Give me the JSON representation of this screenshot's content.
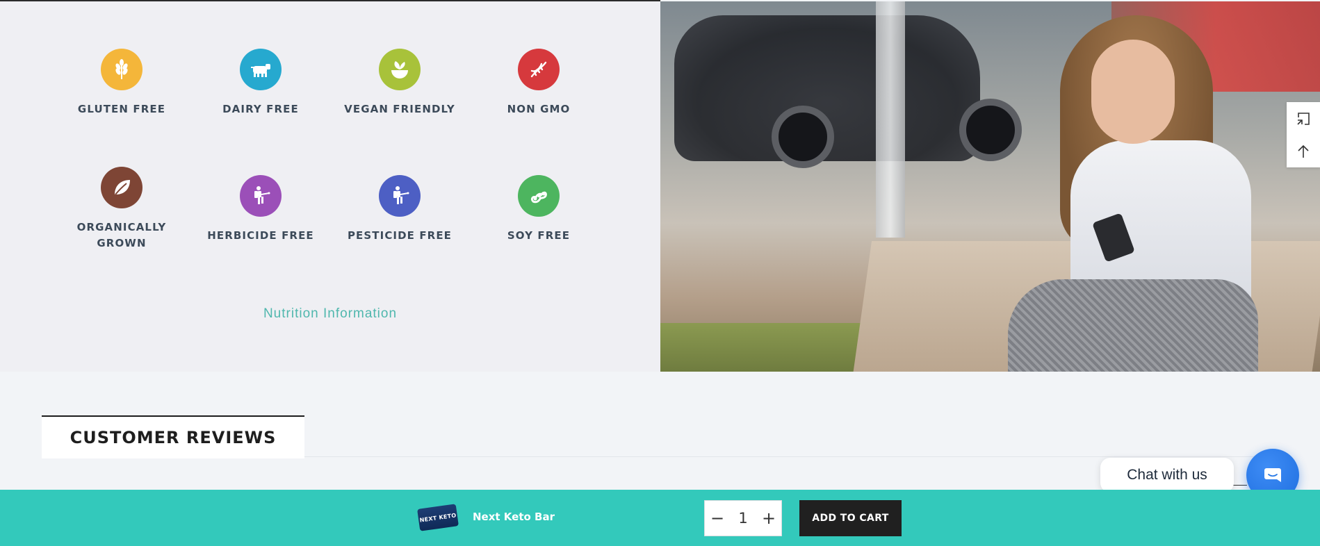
{
  "features": [
    {
      "label": "GLUTEN FREE",
      "icon": "wheat-icon",
      "color": "#f4b63a"
    },
    {
      "label": "DAIRY FREE",
      "icon": "cow-icon",
      "color": "#26a9cf"
    },
    {
      "label": "VEGAN FRIENDLY",
      "icon": "leaf-bowl-icon",
      "color": "#a8c23a"
    },
    {
      "label": "NON GMO",
      "icon": "dna-icon",
      "color": "#d6393d"
    },
    {
      "label": "ORGANICALLY GROWN",
      "icon": "leaf-icon",
      "color": "#7e4535"
    },
    {
      "label": "HERBICIDE FREE",
      "icon": "sprayer-icon",
      "color": "#9b4fb8"
    },
    {
      "label": "PESTICIDE FREE",
      "icon": "sprayer-icon",
      "color": "#4d5fc4"
    },
    {
      "label": "SOY FREE",
      "icon": "soybean-icon",
      "color": "#4db55f"
    }
  ],
  "nutrition_link": "Nutrition Information",
  "reviews": {
    "tab_label": "CUSTOMER REVIEWS"
  },
  "chat": {
    "bubble_text": "Chat with us",
    "button_icon": "chat-icon"
  },
  "side_tools": {
    "expand_icon": "expand-icon",
    "top_icon": "arrow-up-icon"
  },
  "cart_bar": {
    "product_thumb_text": "NEXT KETO",
    "product_name": "Next Keto Bar",
    "quantity": "1",
    "minus": "−",
    "plus": "+",
    "add_to_cart_label": "ADD TO CART",
    "background": "#33c9bb"
  }
}
